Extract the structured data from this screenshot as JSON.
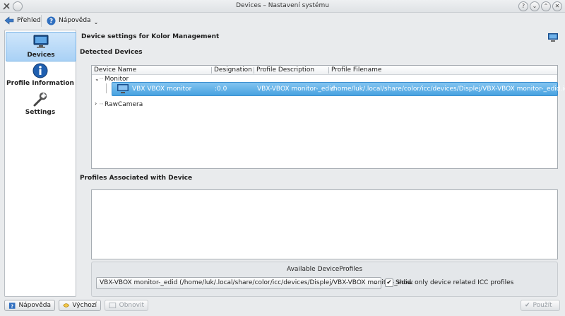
{
  "window": {
    "title": "Devices – Nastavení systému"
  },
  "toolbar": {
    "overview": "Přehled",
    "help": "Nápověda"
  },
  "sidebar": {
    "items": [
      {
        "label": "Devices",
        "icon": "monitor-icon",
        "active": true
      },
      {
        "label": "Profile Information",
        "icon": "info-icon",
        "active": false
      },
      {
        "label": "Settings",
        "icon": "wrench-icon",
        "active": false
      }
    ]
  },
  "main": {
    "header": "Device settings for Kolor Management",
    "detected_title": "Detected Devices",
    "columns": [
      "Device Name",
      "Designation",
      "Profile Description",
      "Profile Filename"
    ],
    "tree": {
      "group1": "Monitor",
      "device": {
        "name": "VBX VBOX monitor",
        "designation": ":0.0",
        "description": "VBX-VBOX monitor-_edid",
        "filename": "/home/luk/.local/share/color/icc/devices/Displej/VBX-VBOX monitor-_edid.icc"
      },
      "group2": "RawCamera"
    },
    "profiles_title": "Profiles Associated with Device",
    "available": {
      "caption": "Available DeviceProfiles",
      "selected": "VBX-VBOX monitor-_edid (/home/luk/.local/share/color/icc/devices/Displej/VBX-VBOX monitor-_edid.",
      "checkbox_label": "Show only device related ICC profiles",
      "checked": true
    }
  },
  "buttons": {
    "help": "Nápověda",
    "defaults": "Výchozí",
    "reset": "Obnovit",
    "apply": "Použít"
  }
}
